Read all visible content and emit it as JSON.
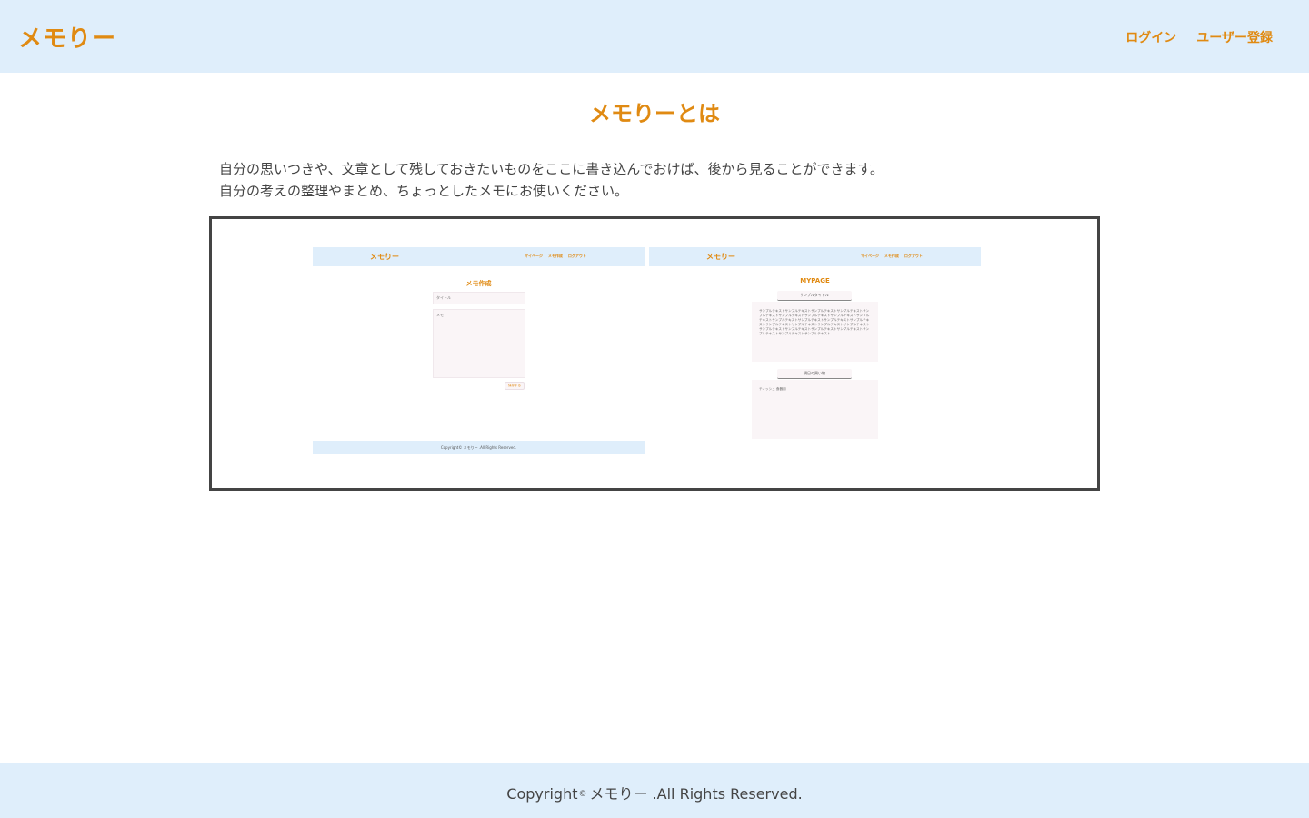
{
  "header": {
    "logo": "メモりー",
    "nav": {
      "login": "ログイン",
      "register": "ユーザー登録"
    }
  },
  "main": {
    "title": "メモりーとは",
    "description": [
      "自分の思いつきや、文章として残しておきたいものをここに書き込んでおけば、後から見ることができます。",
      "自分の考えの整理やまとめ、ちょっとしたメモにお使いください。"
    ]
  },
  "preview": {
    "left": {
      "logo": "メモりー",
      "nav": [
        "マイページ",
        "メモ作成",
        "ログアウト"
      ],
      "title": "メモ作成",
      "title_field": "タイトル",
      "memo_field": "メモ",
      "submit": "保存する",
      "footer": "Copyright© メモりー .All Rights Reserved."
    },
    "right": {
      "logo": "メモりー",
      "nav": [
        "マイページ",
        "メモ作成",
        "ログアウト"
      ],
      "title": "MYPAGE",
      "card1_title": "サンプルタイトル",
      "card1_body": "サンプルテキストサンプルテキストサンプルテキストサンプルテキストサンプルテキストサンプルテキストサンプルテキストサンプルテキストサンプルテキストサンプルテキストサンプルテキストサンプルテキストサンプルテキストサンプルテキストサンプルテキストサンプルテキストサンプルテキストサンプルテキストサンプルテキストサンプルテキストサンプルテキストサンプルテキストサンプルテキストサンプルテキスト",
      "card2_title": "明日の買い物",
      "card2_body": "ティッシュ 食器用"
    }
  },
  "footer": {
    "copyright_prefix": "Copyright",
    "copyright_mark": "©",
    "copyright_suffix": "メモりー .All Rights Reserved."
  },
  "colors": {
    "accent": "#e08a12",
    "header_bg": "#dfeefb",
    "text": "#444444"
  }
}
